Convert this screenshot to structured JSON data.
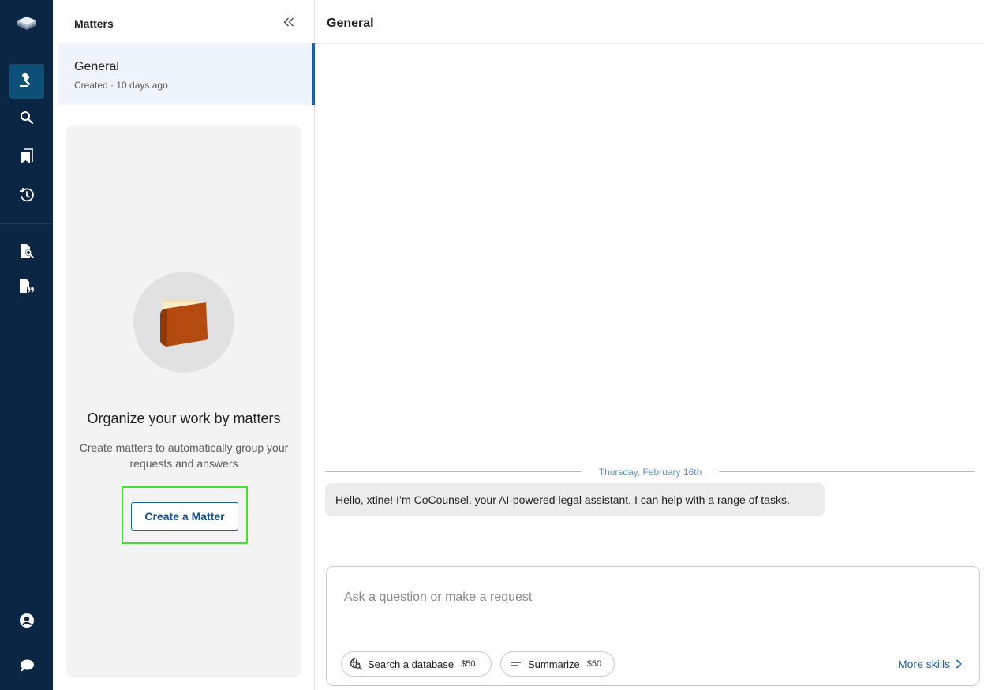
{
  "rail": {
    "items": [
      {
        "icon": "logo-stack-icon"
      },
      {
        "icon": "gavel-icon",
        "active": true
      },
      {
        "icon": "search-icon"
      },
      {
        "icon": "bookmark-icon"
      },
      {
        "icon": "history-icon"
      },
      {
        "icon": "document-search-icon"
      },
      {
        "icon": "document-quote-icon"
      },
      {
        "icon": "user-circle-icon"
      },
      {
        "icon": "chat-bubble-icon"
      }
    ]
  },
  "matters": {
    "title": "Matters",
    "collapse_icon": "double-chevron-left-icon",
    "items": [
      {
        "name": "General",
        "meta": "Created · 10 days ago"
      }
    ],
    "empty": {
      "icon": "folder-icon",
      "title": "Organize your work by matters",
      "description": "Create matters to automatically group your requests and answers",
      "create_label": "Create a Matter"
    }
  },
  "main": {
    "title": "General",
    "date_divider": "Thursday, February 16th",
    "messages": [
      {
        "from": "assistant",
        "text": "Hello, xtine! I’m CoCounsel, your AI-powered legal assistant. I can help with a range of tasks."
      }
    ],
    "composer": {
      "placeholder": "Ask a question or make a request",
      "value": "",
      "skills": [
        {
          "label": "Search a database",
          "price": "$50",
          "icon": "database-search-icon"
        },
        {
          "label": "Summarize",
          "price": "$50",
          "icon": "summarize-lines-icon"
        }
      ],
      "more_label": "More skills"
    }
  },
  "colors": {
    "rail_bg": "#0b2545",
    "rail_active": "#0e4f78",
    "accent": "#1a61a8",
    "highlight_border": "#45e036",
    "folder_brown": "#b0470d"
  }
}
